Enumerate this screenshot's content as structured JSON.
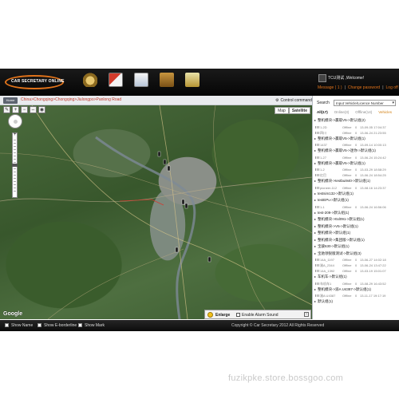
{
  "header": {
    "logo_text": "CAR SECRETARY ONLINE",
    "user_name": "TCU测试 ,Welcome!",
    "links": [
      "Message ( 1 )",
      "Change password",
      "Log off"
    ]
  },
  "breadcrumb": {
    "home_label": "Home",
    "path": "China>Chongqing>Chongqing>Jiulongpo>Panlong Road"
  },
  "control_command": "Control command",
  "map": {
    "map_button": "Map",
    "satellite_button": "Satellite",
    "attribution": "Google"
  },
  "enlarge": {
    "label": "Enlarge",
    "alarm_label": "Enable Alarm Sound"
  },
  "panel": {
    "search_label": "Search",
    "search_placeholder": "Input Vehicle/Licence Number",
    "tabs": [
      "All(17)",
      "Online(3)",
      "Offline(14)",
      "Vehicles"
    ],
    "list": [
      {
        "type": "group",
        "label": "整机模块->赢取V5->默认组(2)"
      },
      {
        "type": "row",
        "name": "1-2D",
        "status": "Offline",
        "zero": "0",
        "time": "13-09-05 17:04:37"
      },
      {
        "type": "row",
        "name": "四川",
        "status": "Offline",
        "zero": "0",
        "time": "13-06-24 21:23:55"
      },
      {
        "type": "group",
        "label": "整机模块->赢取V5->默认组(1)"
      },
      {
        "type": "row",
        "name": "1437",
        "status": "Offline",
        "zero": "0",
        "time": "13-09-14 10:00:13"
      },
      {
        "type": "group",
        "label": "整机模块->赢取V5->迷你->默认组(1)"
      },
      {
        "type": "row",
        "name": "1-27",
        "status": "Offline",
        "zero": "0",
        "time": "13-06-24 15:24:42"
      },
      {
        "type": "group",
        "label": "整机模块->赢取V5->默认组(1)"
      },
      {
        "type": "row",
        "name": "1-2",
        "status": "Offline",
        "zero": "0",
        "time": "13-03-29 18:58:29"
      },
      {
        "type": "row",
        "name": "红巴",
        "status": "Offline",
        "zero": "0",
        "time": "13-06-24 18:54:25"
      },
      {
        "type": "group",
        "label": "整机模块->testbui940->默认组(1)"
      },
      {
        "type": "row",
        "name": "pioneer-112",
        "status": "Offline",
        "zero": "0",
        "time": "13-08-16 14:23:37"
      },
      {
        "type": "group",
        "label": "testsim132->默认组(1)"
      },
      {
        "type": "group",
        "label": "testEPu->默认组(1)"
      },
      {
        "type": "row",
        "name": "1-1",
        "status": "Offline",
        "zero": "0",
        "time": "13-06-24 16:56:06"
      },
      {
        "type": "group",
        "label": "test-209->默认组(1)"
      },
      {
        "type": "group",
        "label": "整机模块->ttxl091->默认组(1)"
      },
      {
        "type": "group",
        "label": "整机模块->V5->默认组(1)"
      },
      {
        "type": "group",
        "label": "整机模块->默认组(1)"
      },
      {
        "type": "group",
        "label": "整机模块->集团版->默认组(1)"
      },
      {
        "type": "group",
        "label": "宝骏630->默认组(1)"
      },
      {
        "type": "group",
        "label": "宝驰领锐版测试->默认组(3)"
      },
      {
        "type": "row",
        "name": "14A_1197",
        "status": "Offline",
        "zero": "0",
        "time": "13-06-27 14:02:18"
      },
      {
        "type": "row",
        "name": "渝A_2344",
        "status": "Offline",
        "zero": "0",
        "time": "13-06-24 13:47:22"
      },
      {
        "type": "row",
        "name": "14A_1392",
        "status": "Offline",
        "zero": "0",
        "time": "13-03-19 15:01:07"
      },
      {
        "type": "group",
        "label": "车机车->默认组(1)"
      },
      {
        "type": "row",
        "name": "车机车1",
        "status": "Offline",
        "zero": "0",
        "time": "13-08-29 16:43:52"
      },
      {
        "type": "group",
        "label": "整机模块->渝A U4387->默认组(1)"
      },
      {
        "type": "row",
        "name": "渝A U4387",
        "status": "Offline",
        "zero": "0",
        "time": "13-11-17 19:17:19"
      },
      {
        "type": "group",
        "label": "默认组(1)"
      }
    ]
  },
  "status_bar": {
    "items": [
      "Show Name",
      "Show E-borderline",
      "Show Mark"
    ],
    "copyright": "Copyright © Car Secretary 2012 All Rights Reserved"
  },
  "watermark": "fuzikpke.store.bossgoo.com"
}
